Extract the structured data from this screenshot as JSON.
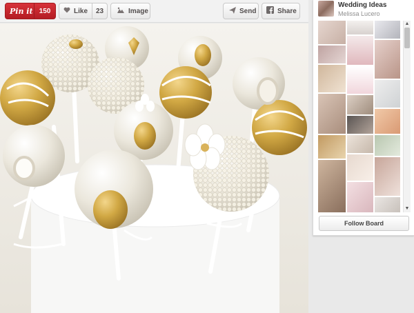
{
  "toolbar": {
    "pin_label": "Pin it",
    "pin_count": "150",
    "like_label": "Like",
    "like_count": "23",
    "image_label": "Image",
    "send_label": "Send",
    "share_label": "Share"
  },
  "icons": {
    "heart": "heart-icon",
    "image": "image-icon",
    "send": "send-icon",
    "facebook": "facebook-icon",
    "scroll_up": "chevron-up-icon",
    "scroll_down": "chevron-down-icon"
  },
  "sidebar": {
    "board_title": "Wedding Ideas",
    "board_owner": "Melissa Lucero",
    "follow_label": "Follow Board"
  },
  "colors": {
    "pin_red": "#c8232c",
    "gold": "#c8a24a",
    "pearl": "#f4f1ea"
  }
}
